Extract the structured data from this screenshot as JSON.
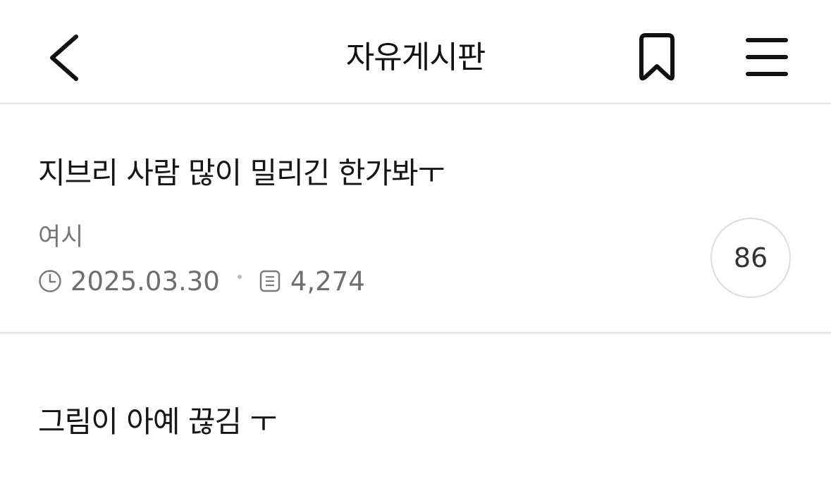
{
  "header": {
    "title": "자유게시판",
    "back_icon": "chevron-left-icon",
    "bookmark_icon": "bookmark-icon",
    "menu_icon": "hamburger-menu-icon"
  },
  "posts": [
    {
      "title": "지브리 사람 많이 밀리긴 한가봐ㅜ",
      "author": "여시",
      "date": "2025.03.30",
      "views": "4,274",
      "comments": "86"
    },
    {
      "title": "그림이 아예 끊김 ㅜ"
    }
  ],
  "colors": {
    "text_primary": "#161616",
    "text_meta": "#6e6e6e",
    "divider": "#e6e6e6",
    "badge_border": "#dddddd"
  }
}
